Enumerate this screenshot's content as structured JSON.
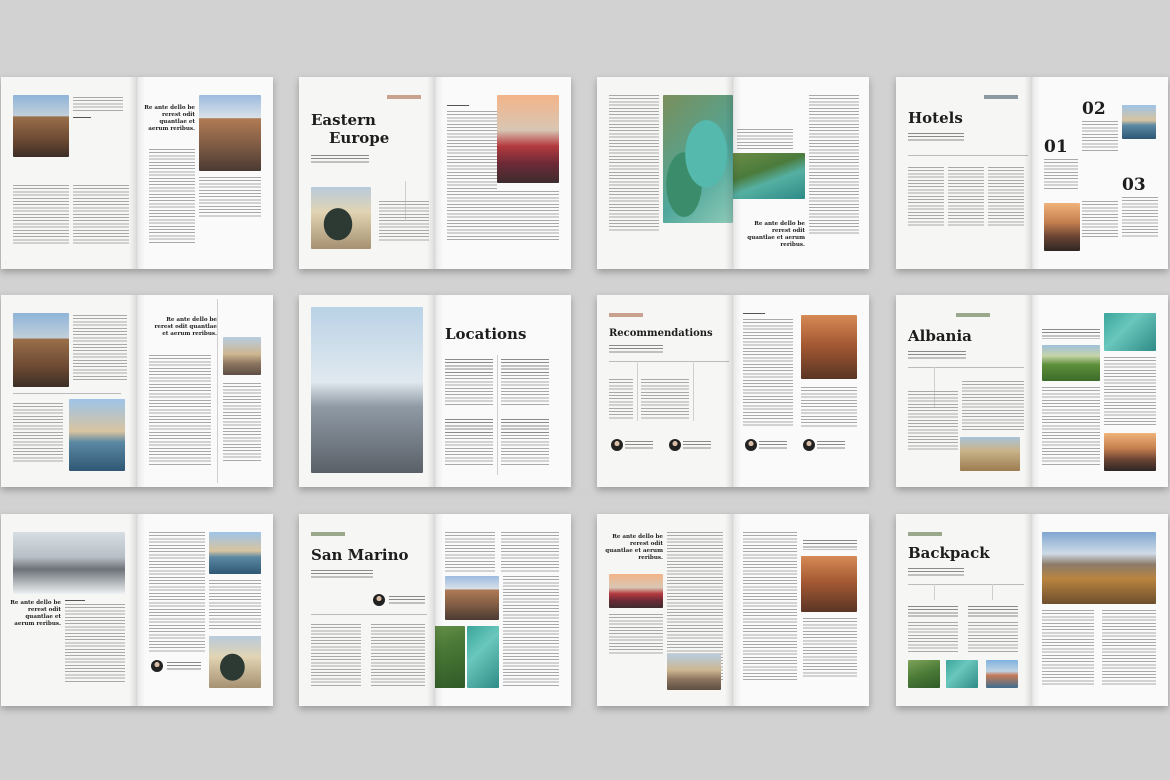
{
  "colors": {
    "background": "#d2d2d2",
    "page": "#f7f7f6",
    "heading": "#1d1d1d",
    "tag_rose": "#c9a28f",
    "tag_sage": "#9aa88c",
    "tag_slate": "#8c98a2"
  },
  "spreads": [
    {
      "quote": "Re ante dello be rerest odit quantlae et aerum reribus."
    },
    {
      "title_line1": "Eastern",
      "title_line2": "Europe"
    },
    {
      "quote": "Re ante dello be rerest odit quantlae et aerum reribus."
    },
    {
      "title": "Hotels",
      "numbers": [
        "02",
        "01",
        "03"
      ]
    },
    {
      "quote": "Re ante dello be rerest odit quantlae et aerum reribus."
    },
    {
      "title": "Locations"
    },
    {
      "title": "Recommendations"
    },
    {
      "title": "Albania"
    },
    {
      "quote": "Re ante dello be rerest odit quantlae et aerum reribus."
    },
    {
      "title": "San Marino"
    },
    {
      "quote": "Re ante dello be rerest odit quantlae et aerum reribus."
    },
    {
      "title": "Backpack"
    }
  ]
}
